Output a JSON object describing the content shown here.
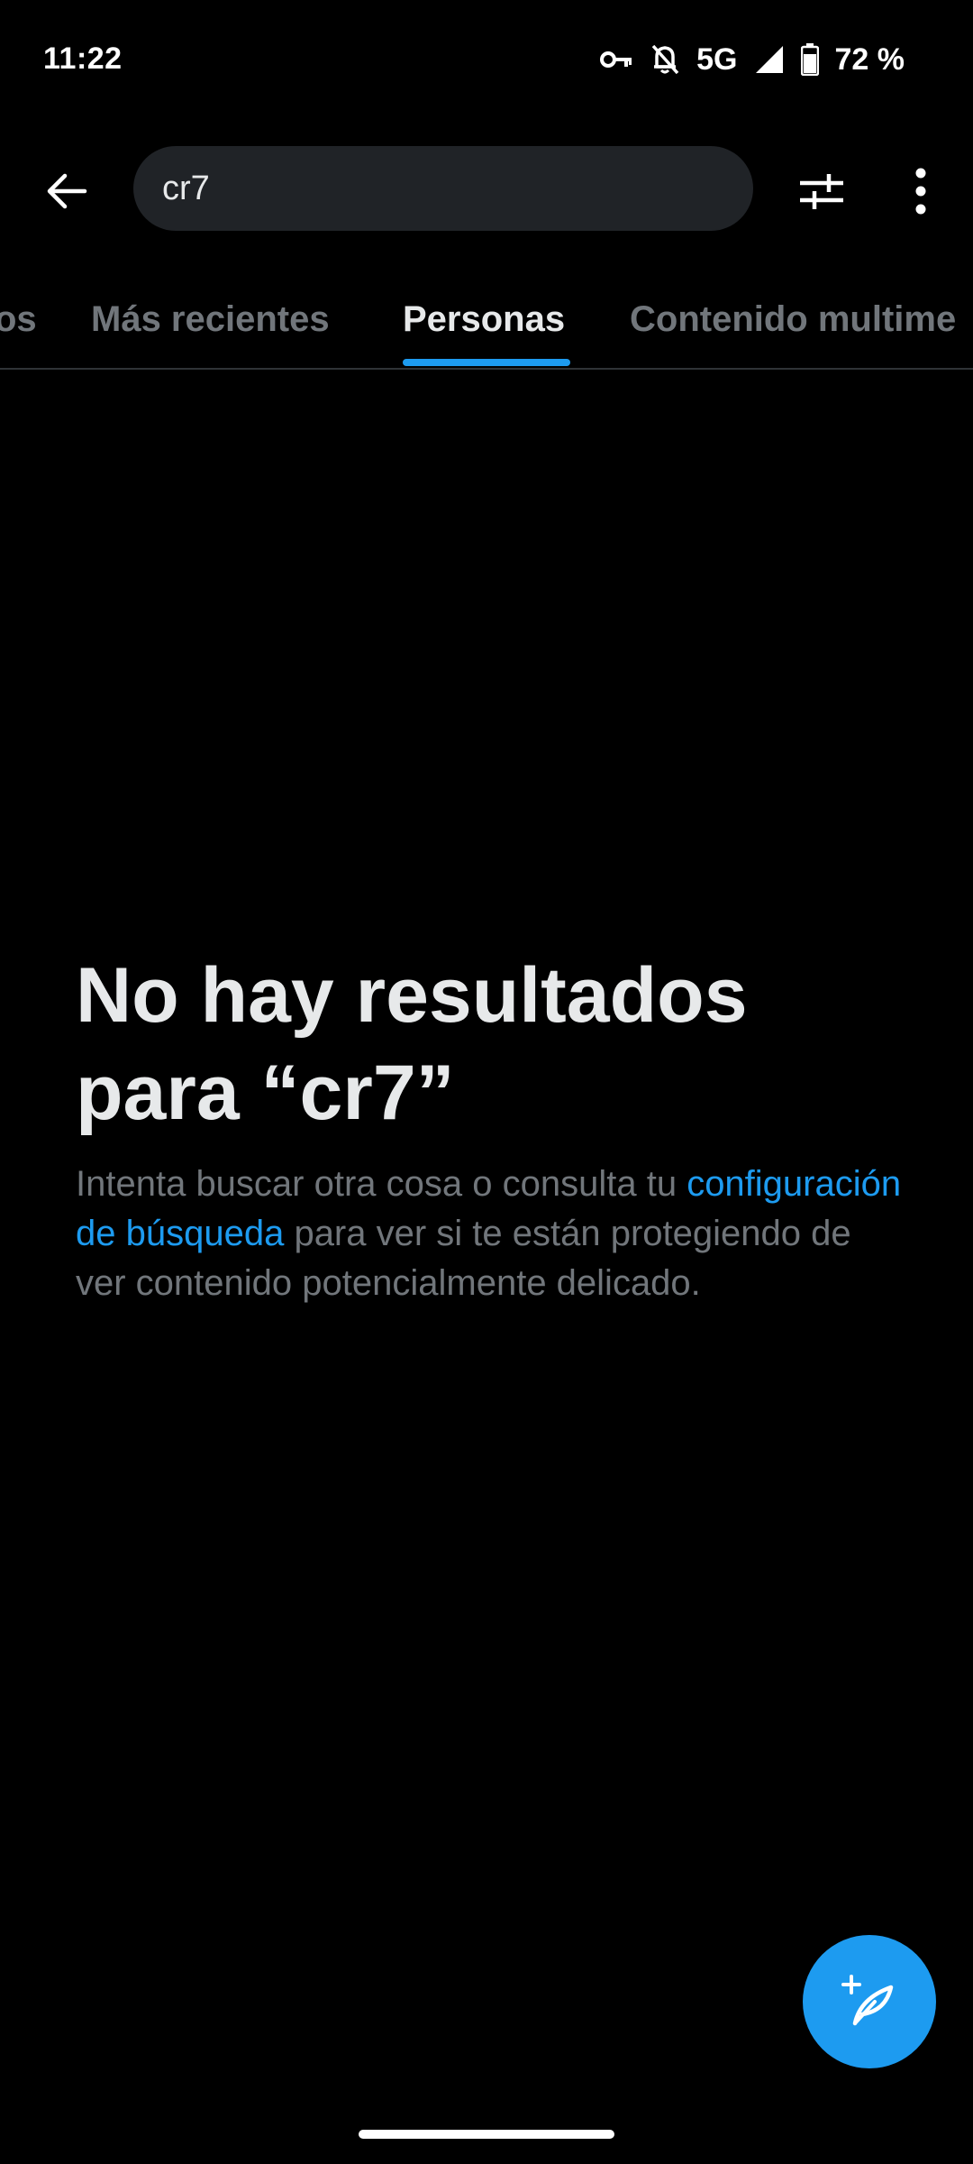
{
  "status_bar": {
    "time": "11:22",
    "network": "5G",
    "battery": "72 %",
    "icons": [
      "vpn-key-icon",
      "bell-off-icon",
      "signal-icon",
      "battery-icon"
    ]
  },
  "search": {
    "query": "cr7",
    "icons": [
      "back-arrow-icon",
      "filter-sliders-icon",
      "more-vertical-icon"
    ]
  },
  "tabs": [
    {
      "label": "Destacados",
      "visible_text": "os",
      "active": false
    },
    {
      "label": "Más recientes",
      "active": false
    },
    {
      "label": "Personas",
      "active": true
    },
    {
      "label": "Contenido multime",
      "active": false
    }
  ],
  "empty_state": {
    "title": "No hay resultados para “cr7”",
    "body_before_link": "Intenta buscar otra cosa o consulta tu ",
    "link": "configuración de búsqueda",
    "body_after_link": " para ver si te están protegiendo de ver contenido potencialmente delicado."
  },
  "fab": {
    "icon": "compose-feather-plus-icon"
  },
  "colors": {
    "background": "#000000",
    "accent": "#1d9bf0",
    "text_primary": "#e7e9ea",
    "text_secondary": "#71767b",
    "search_bg": "#202327"
  }
}
